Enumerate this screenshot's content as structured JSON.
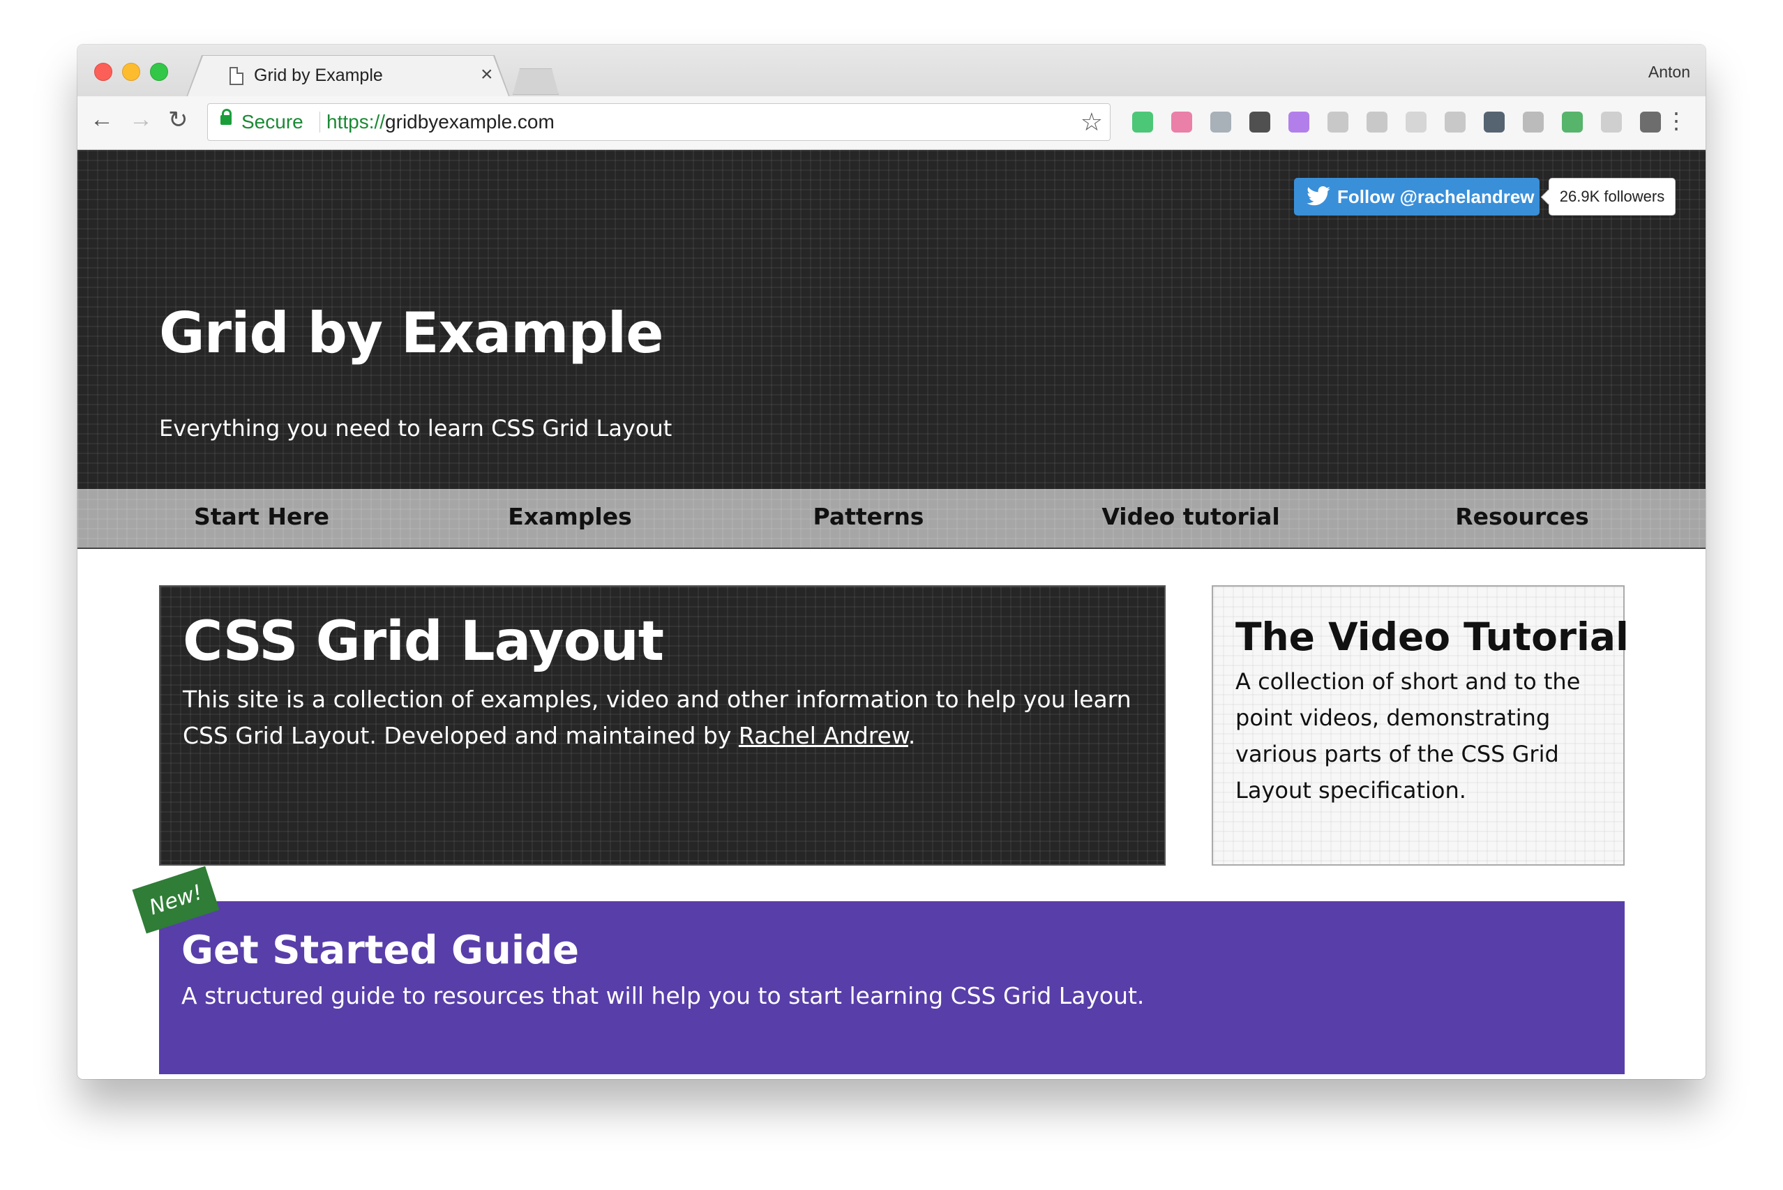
{
  "browser": {
    "tab_title": "Grid by Example",
    "tab_close": "×",
    "profile_name": "Anton",
    "secure_label": "Secure",
    "url_scheme": "https://",
    "url_host": "gridbyexample.com",
    "back": "←",
    "forward": "→",
    "reload": "↻",
    "bookmark": "☆",
    "menu": "⋮",
    "extensions": [
      {
        "icon": "evernote-icon",
        "color": "#2dbe60"
      },
      {
        "icon": "colorzilla-icon",
        "color": "#e86a9a"
      },
      {
        "icon": "dropbox-icon",
        "color": "#9aa3ad"
      },
      {
        "icon": "whatfont-icon",
        "color": "#333333"
      },
      {
        "icon": "paint-icon",
        "color": "#a66ae8"
      },
      {
        "icon": "cast-icon",
        "color": "#c0c0c0"
      },
      {
        "icon": "react-devtools-icon",
        "color": "#c0c0c0"
      },
      {
        "icon": "circle-extension-icon",
        "color": "#d0d0d0"
      },
      {
        "icon": "arrow-extension-icon",
        "color": "#c0c0c0"
      },
      {
        "icon": "s-extension-icon",
        "color": "#3a4a5a"
      },
      {
        "icon": "id-extension-icon",
        "color": "#b0b0b0"
      },
      {
        "icon": "green-extension-icon",
        "color": "#39a852"
      },
      {
        "icon": "grey-extension-icon",
        "color": "#c8c8c8"
      },
      {
        "icon": "thumbs-up-icon",
        "color": "#555555"
      }
    ]
  },
  "header": {
    "follow_button": "Follow @rachelandrew",
    "followers_count": "26.9K followers",
    "title": "Grid by Example",
    "subtitle": "Everything you need to learn CSS Grid Layout"
  },
  "nav": {
    "items": [
      {
        "label": "Start Here"
      },
      {
        "label": "Examples"
      },
      {
        "label": "Patterns"
      },
      {
        "label": "Video tutorial"
      },
      {
        "label": "Resources"
      }
    ]
  },
  "intro": {
    "title": "CSS Grid Layout",
    "text_before": "This site is a collection of examples, video and other information to help you learn CSS Grid Layout. Developed and maintained by ",
    "author_link": "Rachel Andrew",
    "text_after": "."
  },
  "video_card": {
    "title": "The Video Tutorial",
    "text": "A collection of short and to the point videos, demonstrating various parts of the CSS Grid Layout specification."
  },
  "guide": {
    "badge": "New!",
    "title": "Get Started Guide",
    "text": "A structured guide to resources that will help you to start learning CSS Grid Layout.",
    "color": "#583ea9"
  }
}
